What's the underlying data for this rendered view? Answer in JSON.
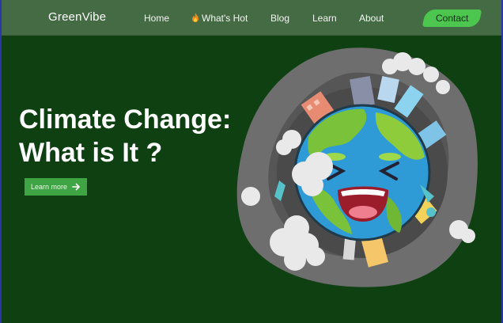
{
  "nav": {
    "brand": "GreenVibe",
    "links": [
      {
        "label": "Home"
      },
      {
        "label": "What's Hot",
        "icon": "flame-icon"
      },
      {
        "label": "Blog"
      },
      {
        "label": "Learn"
      },
      {
        "label": "About"
      }
    ],
    "contact_label": "Contact"
  },
  "hero": {
    "title_line1": "Climate Change:",
    "title_line2": "What is It ?",
    "cta_label": "Learn more",
    "cta_icon": "arrow-right-icon"
  },
  "colors": {
    "background": "#0e4012",
    "navbar": "#456b44",
    "accent": "#4cc64f",
    "button": "#3fa443"
  }
}
